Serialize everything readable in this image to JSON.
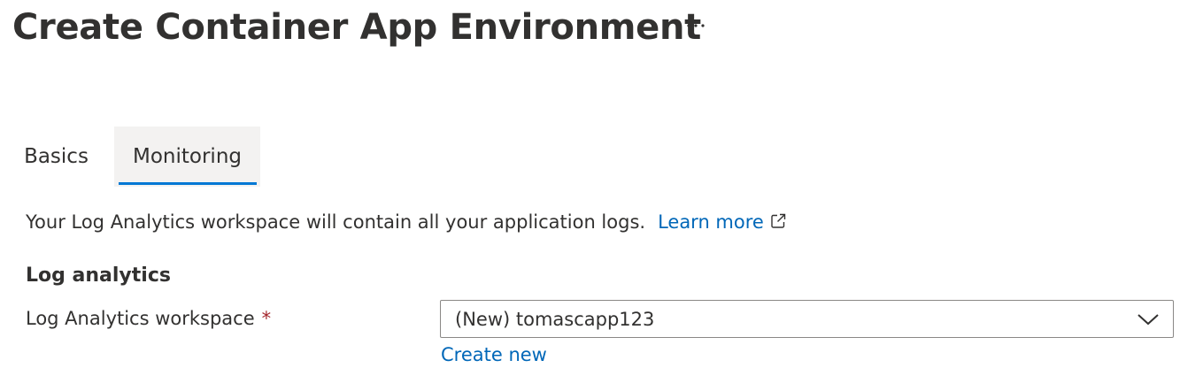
{
  "header": {
    "title": "Create Container App Environment",
    "more_label": "...",
    "more_icon": "more-horizontal-icon"
  },
  "tabs": [
    {
      "label": "Basics",
      "selected": false
    },
    {
      "label": "Monitoring",
      "selected": true
    }
  ],
  "monitoring": {
    "description": "Your Log Analytics workspace will contain all your application logs.",
    "learn_more": "Learn more",
    "learn_more_icon": "external-link-icon",
    "section_title": "Log analytics",
    "workspace_label": "Log Analytics workspace",
    "required_marker": "*",
    "workspace_value": "(New) tomascapp123",
    "dropdown_icon": "chevron-down-icon",
    "create_new": "Create new"
  },
  "colors": {
    "accent": "#0078d4",
    "link": "#0067b8",
    "required": "#a4262c",
    "text": "#323130",
    "tab_selected_bg": "#f3f2f1"
  }
}
